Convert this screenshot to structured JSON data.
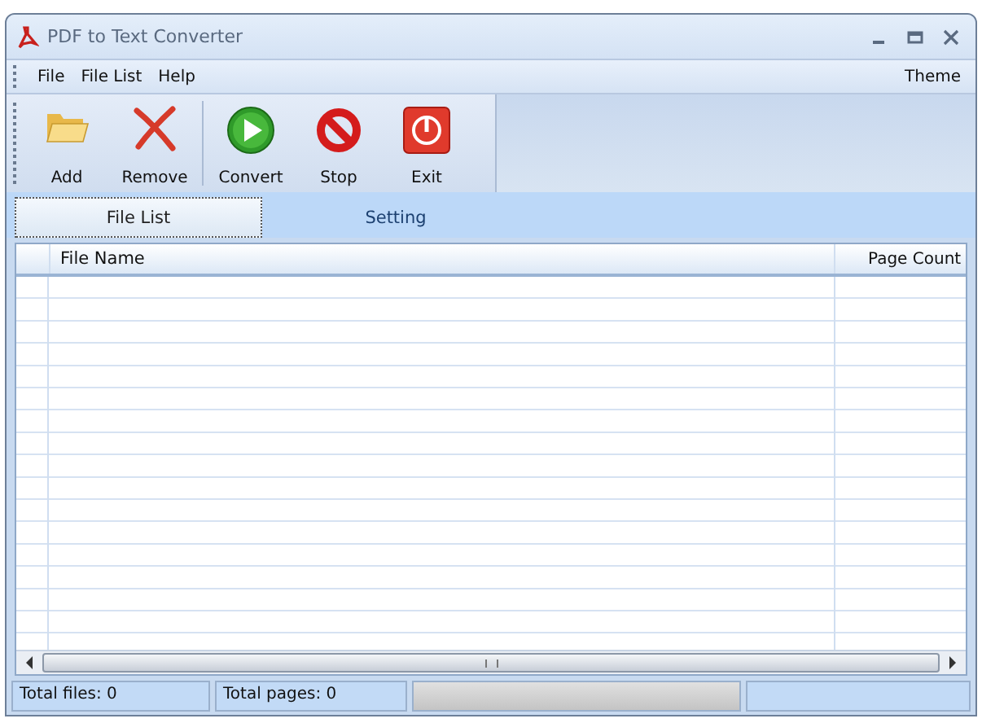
{
  "window": {
    "title": "PDF to Text Converter"
  },
  "menu": [
    {
      "label": "File"
    },
    {
      "label": "File List"
    },
    {
      "label": "Help"
    }
  ],
  "theme_menu": {
    "label": "Theme"
  },
  "toolbar": [
    {
      "label": "Add",
      "kind": "folder"
    },
    {
      "label": "Remove",
      "kind": "cross"
    },
    {
      "label": "Convert",
      "kind": "play"
    },
    {
      "label": "Stop",
      "kind": "stop"
    },
    {
      "label": "Exit",
      "kind": "power"
    }
  ],
  "tabs": [
    {
      "label": "File List",
      "selected": true
    },
    {
      "label": "Setting",
      "selected": false
    }
  ],
  "table": {
    "columns": [
      "File Name",
      "Page Count"
    ]
  },
  "status_bar": {
    "total_files": "Total files: 0",
    "total_pages": "Total pages: 0",
    "progress": {
      "level": 0
    }
  }
}
